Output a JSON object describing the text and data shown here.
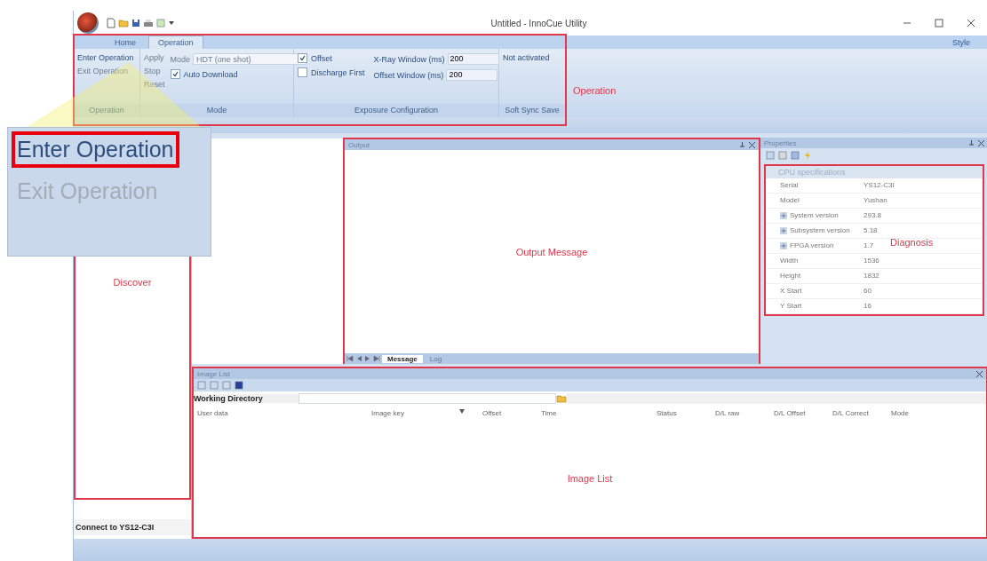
{
  "window": {
    "title": "Untitled - InnoCue Utility"
  },
  "ribbon": {
    "tabs": [
      {
        "label": "Home",
        "selected": false
      },
      {
        "label": "Operation",
        "selected": true
      }
    ],
    "style_menu": "Style",
    "operation_group": {
      "label": "Operation",
      "buttons": [
        {
          "label": "Enter Operation",
          "disabled": false
        },
        {
          "label": "Exit Operation",
          "disabled": true
        }
      ]
    },
    "mode_group": {
      "label": "Mode",
      "buttons": [
        {
          "label": "Apply",
          "disabled": true
        },
        {
          "label": "Stop",
          "disabled": true
        },
        {
          "label": "Reset",
          "disabled": true
        }
      ],
      "mode_label": "Mode",
      "mode_value": "HDT (one shot)",
      "auto_download": {
        "label": "Auto Download",
        "checked": true
      }
    },
    "exposure_group": {
      "label": "Exposure Configuration",
      "checks": [
        {
          "label": "Offset",
          "checked": true
        },
        {
          "label": "Discharge First",
          "checked": false
        }
      ],
      "fields": [
        {
          "label": "X-Ray Window (ms)",
          "value": "200"
        },
        {
          "label": "Offset Window (ms)",
          "value": "200"
        }
      ]
    },
    "sync_group": {
      "label": "Soft Sync Save",
      "status": "Not activated"
    },
    "annotation": "Operation"
  },
  "callout": {
    "items": [
      {
        "label": "Enter Operation",
        "disabled": false,
        "highlighted": true
      },
      {
        "label": "Exit Operation",
        "disabled": true,
        "highlighted": false
      }
    ]
  },
  "discover": {
    "annotation": "Discover",
    "status": "Connect to YS12-C3I"
  },
  "output": {
    "title": "Output",
    "annotation": "Output Message",
    "tabs": [
      {
        "label": "Message",
        "selected": true
      },
      {
        "label": "Log",
        "selected": false
      }
    ]
  },
  "properties": {
    "title": "Properties",
    "annotation": "Diagnosis",
    "category": "CPU specifications",
    "rows": [
      {
        "kind": "value",
        "name": "Serial",
        "value": "YS12-C3I"
      },
      {
        "kind": "value",
        "name": "Model",
        "value": "Yushan"
      },
      {
        "kind": "group",
        "name": "System version",
        "value": "293.8"
      },
      {
        "kind": "group",
        "name": "Subsystem version",
        "value": "5.18"
      },
      {
        "kind": "group",
        "name": "FPGA version",
        "value": "1.7"
      },
      {
        "kind": "value",
        "name": "Width",
        "value": "1536"
      },
      {
        "kind": "value",
        "name": "Height",
        "value": "1832"
      },
      {
        "kind": "value",
        "name": "X Start",
        "value": "60"
      },
      {
        "kind": "value",
        "name": "Y Start",
        "value": "16"
      }
    ]
  },
  "image_list": {
    "title": "Image List",
    "annotation": "Image List",
    "working_directory": "Working Directory",
    "columns": [
      "User data",
      "Image key",
      "Offset",
      "Time",
      "Status",
      "D/L raw",
      "D/L Offset",
      "D/L Correct",
      "Mode"
    ]
  }
}
